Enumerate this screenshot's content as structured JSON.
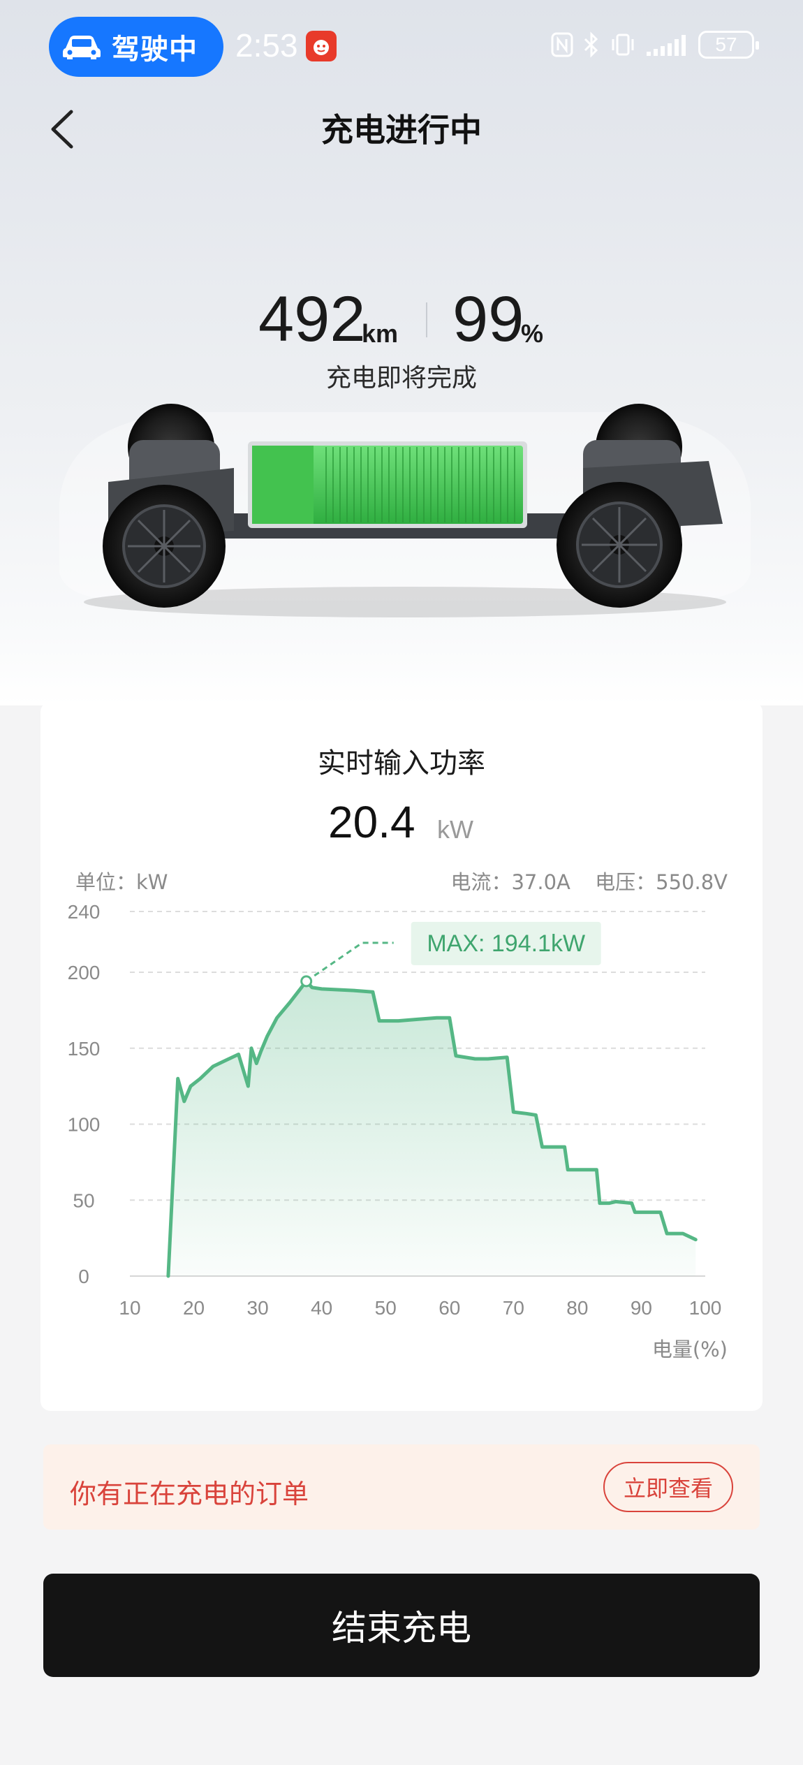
{
  "status_bar": {
    "driving_label": "驾驶中",
    "time": "2:53",
    "battery": "57"
  },
  "header": {
    "title": "充电进行中"
  },
  "summary": {
    "range_value": "492",
    "range_unit": "km",
    "soc_value": "99",
    "soc_unit": "%",
    "status": "充电即将完成"
  },
  "power": {
    "title": "实时输入功率",
    "value": "20.4",
    "unit": "kW",
    "unit_label": "单位：kW",
    "current": "电流：37.0A",
    "voltage": "电压：550.8V"
  },
  "chart_data": {
    "type": "area",
    "xlabel": "电量(%)",
    "ylabel": "",
    "xlim": [
      10,
      100
    ],
    "ylim": [
      0,
      240
    ],
    "xticks": [
      "10",
      "20",
      "30",
      "40",
      "50",
      "60",
      "70",
      "80",
      "90",
      "100"
    ],
    "yticks": [
      "0",
      "50",
      "100",
      "150",
      "200",
      "240"
    ],
    "grid": true,
    "max_label": "MAX: 194.1kW",
    "max_point": [
      37.6,
      194.1
    ],
    "color": "#55b785",
    "x": [
      16,
      17.5,
      18.5,
      19.5,
      21,
      23,
      25,
      27,
      28.5,
      29,
      29.8,
      30.5,
      31.5,
      33,
      35,
      37.6,
      38.5,
      40,
      45,
      48,
      49,
      52,
      55,
      58,
      60,
      61,
      64,
      66,
      69,
      70,
      72,
      73.5,
      74.5,
      78,
      78.5,
      83,
      83.5,
      85,
      86,
      88.5,
      89,
      92,
      93,
      94,
      96.5,
      97,
      98.5
    ],
    "y": [
      0,
      130,
      115,
      125,
      130,
      138,
      142,
      146,
      125,
      150,
      140,
      148,
      158,
      170,
      180,
      194.1,
      190,
      189,
      188,
      187,
      168,
      168,
      169,
      170,
      170,
      145,
      143,
      143,
      144,
      108,
      107,
      106,
      85,
      85,
      70,
      70,
      48,
      48,
      49,
      48,
      42,
      42,
      42,
      28,
      28,
      27,
      24
    ]
  },
  "order": {
    "text": "你有正在充电的订单",
    "button": "立即查看"
  },
  "actions": {
    "end_charging": "结束充电"
  },
  "colors": {
    "accent_blue": "#1677ff",
    "battery_green": "#3fbf55",
    "chart_green": "#55b785",
    "alert_red": "#d9433b",
    "alert_bg": "#fdf1ea"
  }
}
